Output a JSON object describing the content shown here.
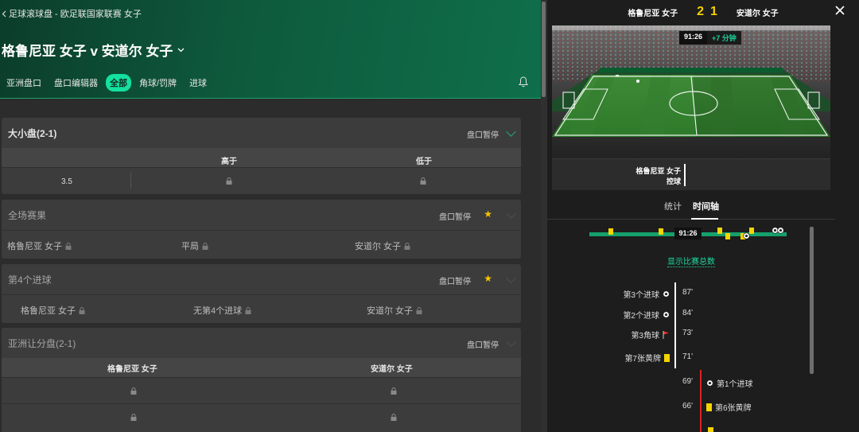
{
  "left": {
    "breadcrumb": "足球滚球盘 - 欧足联国家联赛 女子",
    "title": "格鲁尼亚 女子 v 安道尔 女子",
    "tabs": [
      {
        "label": "亚洲盘口",
        "active": false
      },
      {
        "label": "盘口编辑器",
        "active": false
      },
      {
        "label": "全部",
        "active": true
      },
      {
        "label": "角球/罚牌",
        "active": false
      },
      {
        "label": "进球",
        "active": false
      }
    ],
    "markets": {
      "over_under": {
        "title": "大小盘(2-1)",
        "status": "盘口暂停",
        "col_over": "高于",
        "col_under": "低于",
        "line": "3.5"
      },
      "full_time": {
        "title": "全场赛果",
        "status": "盘口暂停",
        "home": "格鲁尼亚 女子",
        "draw": "平局",
        "away": "安道尔 女子"
      },
      "fourth_goal": {
        "title": "第4个进球",
        "status": "盘口暂停",
        "home": "格鲁尼亚 女子",
        "none": "无第4个进球",
        "away": "安道尔 女子"
      },
      "asian_handicap": {
        "title": "亚洲让分盘(2-1)",
        "status": "盘口暂停",
        "home": "格鲁尼亚 女子",
        "away": "安道尔 女子"
      }
    }
  },
  "right": {
    "home_team": "格鲁尼亚 女子",
    "away_team": "安道尔 女子",
    "home_score": "2",
    "away_score": "1",
    "clock": "91:26",
    "added_time": "+7 分钟",
    "event_team": "格鲁尼亚 女子",
    "event_action": "控球",
    "tabs": {
      "stats": "统计",
      "timeline": "时间轴"
    },
    "timeline_time": "91:26",
    "show_totals": "显示比赛总数",
    "events": [
      {
        "label": "第3个进球",
        "minute": "87'",
        "type": "goal",
        "side": "home"
      },
      {
        "label": "第2个进球",
        "minute": "84'",
        "type": "goal",
        "side": "home"
      },
      {
        "label": "第3角球",
        "minute": "73'",
        "type": "corner",
        "side": "home"
      },
      {
        "label": "第7张黄牌",
        "minute": "71'",
        "type": "yellow",
        "side": "home"
      },
      {
        "label": "第1个进球",
        "minute": "69'",
        "type": "goal",
        "side": "away"
      },
      {
        "label": "第6张黄牌",
        "minute": "66'",
        "type": "yellow",
        "side": "away"
      }
    ],
    "colors": {
      "accent": "#14e0a0",
      "yellow_card": "#f5d400",
      "score": "#f7d000"
    }
  }
}
